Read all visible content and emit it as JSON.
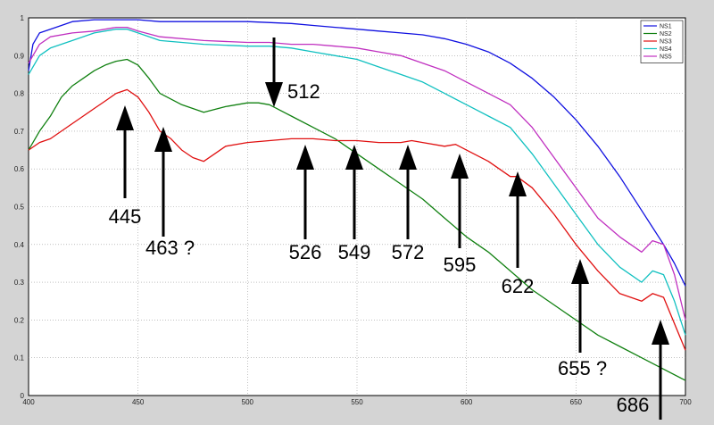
{
  "chart_data": {
    "type": "line",
    "xlim": [
      400,
      700
    ],
    "ylim": [
      0,
      1
    ],
    "x_ticks": [
      "400",
      "450",
      "500",
      "550",
      "600",
      "650",
      "700"
    ],
    "y_ticks": [
      "0",
      "0.1",
      "0.2",
      "0.3",
      "0.4",
      "0.5",
      "0.6",
      "0.7",
      "0.8",
      "0.9",
      "1"
    ],
    "grid": "dotted",
    "legend_position": "top-right",
    "series": [
      {
        "name": "NS1",
        "color": "#1010e0",
        "x": [
          400,
          402,
          405,
          410,
          415,
          420,
          430,
          440,
          445,
          450,
          460,
          480,
          500,
          520,
          530,
          540,
          550,
          560,
          570,
          580,
          590,
          600,
          610,
          620,
          630,
          640,
          650,
          660,
          670,
          680,
          690,
          695,
          700
        ],
        "y": [
          0.86,
          0.93,
          0.96,
          0.97,
          0.98,
          0.99,
          0.995,
          0.995,
          0.995,
          0.995,
          0.99,
          0.99,
          0.99,
          0.985,
          0.98,
          0.975,
          0.97,
          0.965,
          0.96,
          0.955,
          0.945,
          0.93,
          0.91,
          0.88,
          0.84,
          0.79,
          0.73,
          0.66,
          0.58,
          0.49,
          0.4,
          0.35,
          0.29
        ]
      },
      {
        "name": "NS2",
        "color": "#108010",
        "x": [
          400,
          405,
          410,
          415,
          420,
          425,
          430,
          435,
          440,
          445,
          450,
          455,
          460,
          470,
          480,
          490,
          500,
          505,
          510,
          520,
          530,
          540,
          550,
          560,
          570,
          580,
          590,
          600,
          610,
          620,
          630,
          640,
          650,
          660,
          670,
          680,
          690,
          700
        ],
        "y": [
          0.65,
          0.7,
          0.74,
          0.79,
          0.82,
          0.84,
          0.86,
          0.875,
          0.885,
          0.89,
          0.875,
          0.84,
          0.8,
          0.77,
          0.75,
          0.765,
          0.775,
          0.775,
          0.77,
          0.74,
          0.71,
          0.68,
          0.64,
          0.6,
          0.56,
          0.52,
          0.47,
          0.42,
          0.38,
          0.33,
          0.28,
          0.24,
          0.2,
          0.16,
          0.13,
          0.1,
          0.07,
          0.04
        ]
      },
      {
        "name": "NS3",
        "color": "#e01010",
        "x": [
          400,
          405,
          410,
          415,
          420,
          425,
          430,
          435,
          440,
          445,
          450,
          455,
          460,
          465,
          470,
          475,
          480,
          485,
          490,
          500,
          510,
          520,
          530,
          540,
          550,
          560,
          570,
          575,
          580,
          590,
          595,
          600,
          610,
          620,
          623,
          630,
          640,
          645,
          650,
          660,
          670,
          680,
          685,
          690,
          700
        ],
        "y": [
          0.65,
          0.67,
          0.68,
          0.7,
          0.72,
          0.74,
          0.76,
          0.78,
          0.8,
          0.81,
          0.79,
          0.75,
          0.7,
          0.68,
          0.65,
          0.63,
          0.62,
          0.64,
          0.66,
          0.67,
          0.675,
          0.68,
          0.68,
          0.675,
          0.675,
          0.67,
          0.67,
          0.675,
          0.67,
          0.66,
          0.665,
          0.65,
          0.62,
          0.58,
          0.58,
          0.55,
          0.48,
          0.44,
          0.4,
          0.33,
          0.27,
          0.25,
          0.27,
          0.26,
          0.12
        ]
      },
      {
        "name": "NS4",
        "color": "#10c0c0",
        "x": [
          400,
          405,
          410,
          420,
          430,
          440,
          445,
          450,
          460,
          480,
          500,
          510,
          520,
          530,
          540,
          550,
          560,
          570,
          580,
          590,
          600,
          610,
          620,
          630,
          640,
          650,
          660,
          670,
          680,
          685,
          690,
          695,
          700
        ],
        "y": [
          0.85,
          0.9,
          0.92,
          0.94,
          0.96,
          0.97,
          0.97,
          0.96,
          0.94,
          0.93,
          0.925,
          0.925,
          0.92,
          0.91,
          0.9,
          0.89,
          0.87,
          0.85,
          0.83,
          0.8,
          0.77,
          0.74,
          0.71,
          0.64,
          0.56,
          0.48,
          0.4,
          0.34,
          0.3,
          0.33,
          0.32,
          0.25,
          0.16
        ]
      },
      {
        "name": "NS5",
        "color": "#c030c0",
        "x": [
          400,
          405,
          410,
          420,
          430,
          440,
          445,
          450,
          460,
          480,
          500,
          510,
          520,
          530,
          540,
          550,
          560,
          570,
          580,
          590,
          600,
          610,
          620,
          630,
          640,
          650,
          660,
          670,
          680,
          685,
          690,
          695,
          700
        ],
        "y": [
          0.88,
          0.93,
          0.95,
          0.96,
          0.965,
          0.975,
          0.975,
          0.965,
          0.95,
          0.94,
          0.935,
          0.935,
          0.93,
          0.93,
          0.925,
          0.92,
          0.91,
          0.9,
          0.88,
          0.86,
          0.83,
          0.8,
          0.77,
          0.71,
          0.63,
          0.55,
          0.47,
          0.42,
          0.38,
          0.41,
          0.4,
          0.32,
          0.2
        ]
      }
    ],
    "annotations": [
      {
        "label": "445",
        "direction": "up",
        "x": 445
      },
      {
        "label": "463 ?",
        "direction": "up",
        "x": 463
      },
      {
        "label": "512",
        "direction": "down",
        "x": 512
      },
      {
        "label": "526",
        "direction": "up",
        "x": 526
      },
      {
        "label": "549",
        "direction": "up",
        "x": 549
      },
      {
        "label": "572",
        "direction": "up",
        "x": 572
      },
      {
        "label": "595",
        "direction": "up",
        "x": 595
      },
      {
        "label": "622",
        "direction": "up",
        "x": 622
      },
      {
        "label": "655 ?",
        "direction": "up",
        "x": 655
      },
      {
        "label": "686",
        "direction": "up",
        "x": 686
      }
    ]
  }
}
